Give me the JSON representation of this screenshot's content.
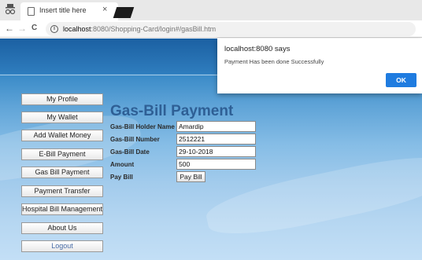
{
  "browser": {
    "tab_title": "Insert title here",
    "tab_close": "×",
    "url_host": "localhost",
    "url_rest": ":8080/Shopping-Card/login#/gasBill.htm",
    "back_glyph": "←",
    "forward_glyph": "→",
    "reload_glyph": "C",
    "info_glyph": "i"
  },
  "sidebar": {
    "items": [
      {
        "label": "My Profile"
      },
      {
        "label": "My Wallet"
      },
      {
        "label": "Add Wallet Money"
      },
      {
        "label": "E-Bill Payment"
      },
      {
        "label": "Gas Bill Payment"
      },
      {
        "label": "Payment Transfer"
      },
      {
        "label": "Hospital Bill Management"
      },
      {
        "label": "About Us"
      },
      {
        "label": "Logout"
      }
    ]
  },
  "form": {
    "heading": "Gas-Bill Payment",
    "holder_label": "Gas-Bill Holder Name",
    "holder_value": "Amardip",
    "number_label": "Gas-Bill Number",
    "number_value": "2512221",
    "date_label": "Gas-Bill Date",
    "date_value": "29-10-2018",
    "amount_label": "Amount",
    "amount_value": "500",
    "pay_label": "Pay Bill",
    "pay_button": "Pay Bill"
  },
  "dialog": {
    "title": "localhost:8080 says",
    "message": "Payment Has been done Successfully",
    "ok": "OK"
  },
  "colors": {
    "accent": "#1f7ce0",
    "heading": "#2e5f95",
    "banner": "#1b60a2"
  }
}
